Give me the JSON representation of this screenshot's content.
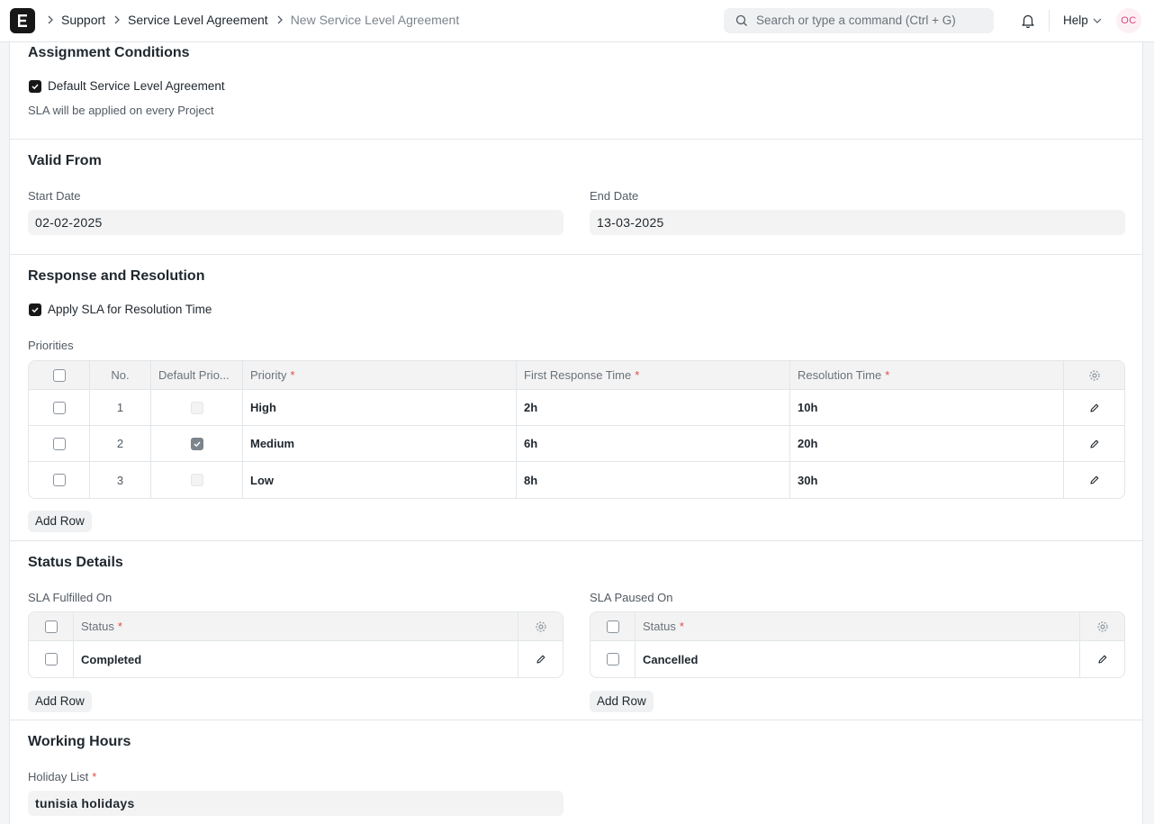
{
  "navbar": {
    "breadcrumbs": [
      "Support",
      "Service Level Agreement",
      "New Service Level Agreement"
    ],
    "search_placeholder": "Search or type a command (Ctrl + G)",
    "help_label": "Help",
    "avatar_initials": "OC"
  },
  "assignment": {
    "title": "Assignment Conditions",
    "default_sla_label": "Default Service Level Agreement",
    "default_sla_checked": true,
    "description": "SLA will be applied on every Project"
  },
  "valid_from": {
    "title": "Valid From",
    "start_date_label": "Start Date",
    "start_date_value": "02-02-2025",
    "end_date_label": "End Date",
    "end_date_value": "13-03-2025"
  },
  "response": {
    "title": "Response and Resolution",
    "apply_sla_label": "Apply SLA for Resolution Time",
    "apply_sla_checked": true,
    "priorities_label": "Priorities",
    "columns": {
      "no": "No.",
      "default_priority": "Default Prio...",
      "priority": "Priority",
      "first_response": "First Response Time",
      "resolution": "Resolution Time"
    },
    "rows": [
      {
        "no": "1",
        "default": false,
        "priority": "High",
        "first_response": "2h",
        "resolution": "10h"
      },
      {
        "no": "2",
        "default": true,
        "priority": "Medium",
        "first_response": "6h",
        "resolution": "20h"
      },
      {
        "no": "3",
        "default": false,
        "priority": "Low",
        "first_response": "8h",
        "resolution": "30h"
      }
    ],
    "add_row_label": "Add Row"
  },
  "status_details": {
    "title": "Status Details",
    "fulfilled_label": "SLA Fulfilled On",
    "paused_label": "SLA Paused On",
    "status_col": "Status",
    "fulfilled_rows": [
      "Completed"
    ],
    "paused_rows": [
      "Cancelled"
    ],
    "add_row_label": "Add Row"
  },
  "working_hours": {
    "title": "Working Hours",
    "holiday_list_label": "Holiday List",
    "holiday_list_value": "tunisia holidays"
  },
  "colors": {
    "accent": "#171717",
    "required": "#e24c4c",
    "avatar_bg": "#fdf0f5",
    "avatar_fg": "#d1467e"
  }
}
